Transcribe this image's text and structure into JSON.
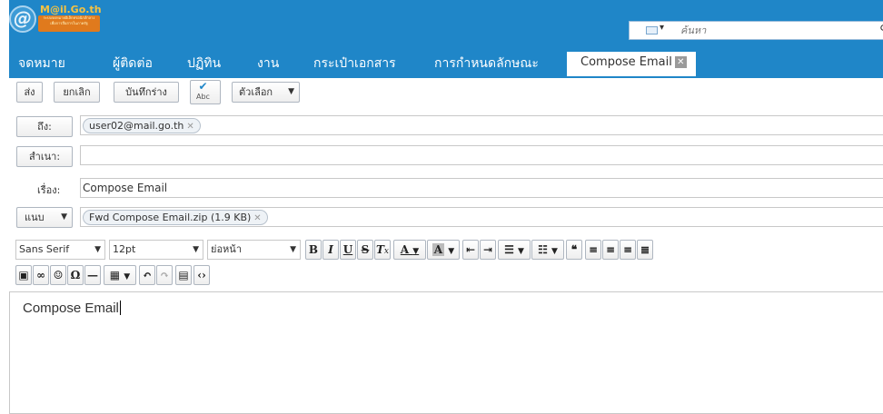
{
  "header": {
    "logo_text": "M@il.Go.th",
    "logo_sub_1": "ระบบจดหมายอิเล็กทรอนิกส์กลาง",
    "logo_sub_2": "เพื่อการสื่อสารในภาครัฐ",
    "search_placeholder": "ค้นหา"
  },
  "tabs": [
    {
      "label": "จดหมาย"
    },
    {
      "label": "ผู้ติดต่อ"
    },
    {
      "label": "ปฏิทิน"
    },
    {
      "label": "งาน"
    },
    {
      "label": "กระเป๋าเอกสาร"
    },
    {
      "label": "การกำหนดลักษณะ"
    },
    {
      "label": "Compose Email",
      "active": true
    }
  ],
  "toolbar": {
    "send": "ส่ง",
    "cancel": "ยกเลิก",
    "save_draft": "บันทึกร่าง",
    "spellcheck_abc": "Abc",
    "options": "ตัวเลือก"
  },
  "fields": {
    "to_label": "ถึง:",
    "to_recipient": "user02@mail.go.th",
    "cc_label": "สำเนา:",
    "subject_label": "เรื่อง:",
    "subject_value": "Compose Email",
    "attach_label": "แนบ",
    "attachment": "Fwd Compose Email.zip (1.9 KB)"
  },
  "editor_toolbar": {
    "font_family": "Sans Serif",
    "font_size": "12pt",
    "paragraph": "ย่อหน้า"
  },
  "editor": {
    "body_text": "Compose Email"
  },
  "colors": {
    "header_blue": "#1f86c8",
    "logo_orange": "#e07a1d"
  }
}
